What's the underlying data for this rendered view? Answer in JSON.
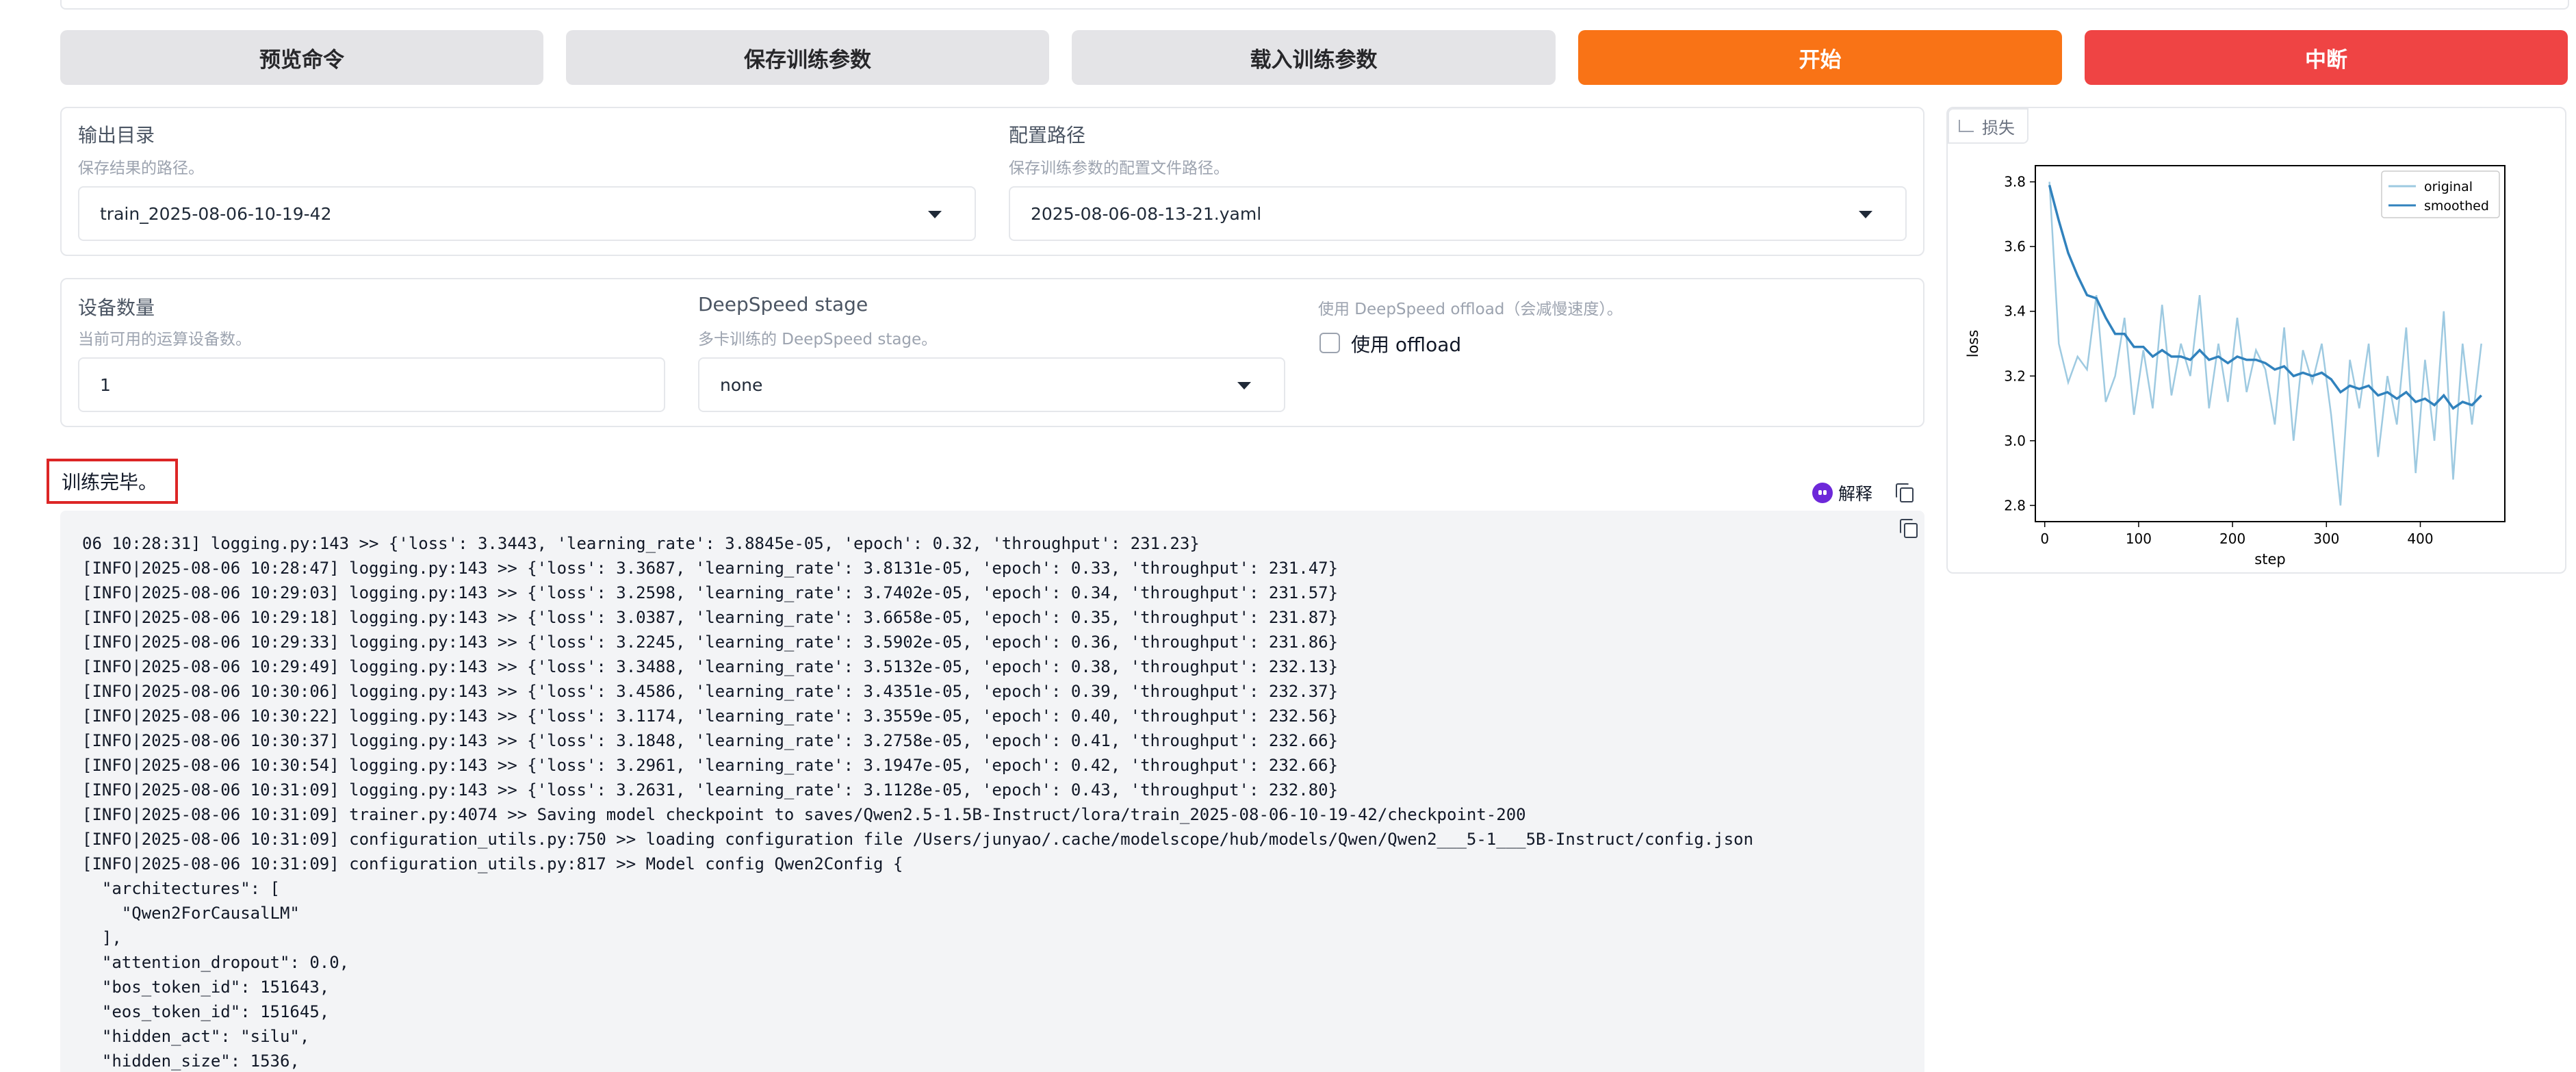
{
  "buttons": {
    "preview": "预览命令",
    "save": "保存训练参数",
    "load": "载入训练参数",
    "start": "开始",
    "abort": "中断"
  },
  "output_dir": {
    "label": "输出目录",
    "info": "保存结果的路径。",
    "value": "train_2025-08-06-10-19-42"
  },
  "config_path": {
    "label": "配置路径",
    "info": "保存训练参数的配置文件路径。",
    "value": "2025-08-06-08-13-21.yaml"
  },
  "device_count": {
    "label": "设备数量",
    "info": "当前可用的运算设备数。",
    "value": "1"
  },
  "ds_stage": {
    "label": "DeepSpeed stage",
    "info": "多卡训练的 DeepSpeed stage。",
    "value": "none"
  },
  "ds_offload": {
    "info": "使用 DeepSpeed offload（会减慢速度）。",
    "label": "使用 offload",
    "checked": false
  },
  "status_text": "训练完毕。",
  "explain_label": "解释",
  "log_lines": [
    "06 10:28:31] logging.py:143 >> {'loss': 3.3443, 'learning_rate': 3.8845e-05, 'epoch': 0.32, 'throughput': 231.23}",
    "[INFO|2025-08-06 10:28:47] logging.py:143 >> {'loss': 3.3687, 'learning_rate': 3.8131e-05, 'epoch': 0.33, 'throughput': 231.47}",
    "[INFO|2025-08-06 10:29:03] logging.py:143 >> {'loss': 3.2598, 'learning_rate': 3.7402e-05, 'epoch': 0.34, 'throughput': 231.57}",
    "[INFO|2025-08-06 10:29:18] logging.py:143 >> {'loss': 3.0387, 'learning_rate': 3.6658e-05, 'epoch': 0.35, 'throughput': 231.87}",
    "[INFO|2025-08-06 10:29:33] logging.py:143 >> {'loss': 3.2245, 'learning_rate': 3.5902e-05, 'epoch': 0.36, 'throughput': 231.86}",
    "[INFO|2025-08-06 10:29:49] logging.py:143 >> {'loss': 3.3488, 'learning_rate': 3.5132e-05, 'epoch': 0.38, 'throughput': 232.13}",
    "[INFO|2025-08-06 10:30:06] logging.py:143 >> {'loss': 3.4586, 'learning_rate': 3.4351e-05, 'epoch': 0.39, 'throughput': 232.37}",
    "[INFO|2025-08-06 10:30:22] logging.py:143 >> {'loss': 3.1174, 'learning_rate': 3.3559e-05, 'epoch': 0.40, 'throughput': 232.56}",
    "[INFO|2025-08-06 10:30:37] logging.py:143 >> {'loss': 3.1848, 'learning_rate': 3.2758e-05, 'epoch': 0.41, 'throughput': 232.66}",
    "[INFO|2025-08-06 10:30:54] logging.py:143 >> {'loss': 3.2961, 'learning_rate': 3.1947e-05, 'epoch': 0.42, 'throughput': 232.66}",
    "[INFO|2025-08-06 10:31:09] logging.py:143 >> {'loss': 3.2631, 'learning_rate': 3.1128e-05, 'epoch': 0.43, 'throughput': 232.80}",
    "[INFO|2025-08-06 10:31:09] trainer.py:4074 >> Saving model checkpoint to saves/Qwen2.5-1.5B-Instruct/lora/train_2025-08-06-10-19-42/checkpoint-200",
    "[INFO|2025-08-06 10:31:09] configuration_utils.py:750 >> loading configuration file /Users/junyao/.cache/modelscope/hub/models/Qwen/Qwen2___5-1___5B-Instruct/config.json",
    "[INFO|2025-08-06 10:31:09] configuration_utils.py:817 >> Model config Qwen2Config {",
    "  \"architectures\": [",
    "    \"Qwen2ForCausalLM\"",
    "  ],",
    "  \"attention_dropout\": 0.0,",
    "  \"bos_token_id\": 151643,",
    "  \"eos_token_id\": 151645,",
    "  \"hidden_act\": \"silu\",",
    "  \"hidden_size\": 1536,"
  ],
  "plot": {
    "tab_label": "损失",
    "colors": {
      "original": "#9ecae1",
      "smoothed": "#3182bd"
    }
  },
  "chart_data": {
    "type": "line",
    "title": "",
    "xlabel": "step",
    "ylabel": "loss",
    "xlim": [
      -10,
      490
    ],
    "ylim": [
      2.75,
      3.85
    ],
    "xticks": [
      0,
      100,
      200,
      300,
      400
    ],
    "yticks": [
      2.8,
      3.0,
      3.2,
      3.4,
      3.6,
      3.8
    ],
    "legend": "top-right",
    "series": [
      {
        "name": "original",
        "x": [
          5,
          15,
          25,
          35,
          45,
          55,
          65,
          75,
          85,
          95,
          105,
          115,
          125,
          135,
          145,
          155,
          165,
          175,
          185,
          195,
          205,
          215,
          225,
          235,
          245,
          255,
          265,
          275,
          285,
          295,
          305,
          315,
          325,
          335,
          345,
          355,
          365,
          375,
          385,
          395,
          405,
          415,
          425,
          435,
          445,
          455,
          465
        ],
        "y": [
          3.8,
          3.3,
          3.18,
          3.26,
          3.22,
          3.45,
          3.12,
          3.2,
          3.38,
          3.08,
          3.28,
          3.1,
          3.42,
          3.14,
          3.3,
          3.2,
          3.45,
          3.1,
          3.3,
          3.12,
          3.38,
          3.15,
          3.28,
          3.22,
          3.05,
          3.35,
          3.0,
          3.28,
          3.18,
          3.3,
          3.08,
          2.8,
          3.25,
          3.1,
          3.3,
          2.95,
          3.2,
          3.05,
          3.35,
          2.9,
          3.25,
          3.0,
          3.4,
          2.88,
          3.3,
          3.05,
          3.3
        ]
      },
      {
        "name": "smoothed",
        "x": [
          5,
          15,
          25,
          35,
          45,
          55,
          65,
          75,
          85,
          95,
          105,
          115,
          125,
          135,
          145,
          155,
          165,
          175,
          185,
          195,
          205,
          215,
          225,
          235,
          245,
          255,
          265,
          275,
          285,
          295,
          305,
          315,
          325,
          335,
          345,
          355,
          365,
          375,
          385,
          395,
          405,
          415,
          425,
          435,
          445,
          455,
          465
        ],
        "y": [
          3.79,
          3.68,
          3.58,
          3.51,
          3.45,
          3.44,
          3.38,
          3.33,
          3.33,
          3.29,
          3.29,
          3.26,
          3.28,
          3.26,
          3.26,
          3.25,
          3.28,
          3.25,
          3.26,
          3.24,
          3.26,
          3.25,
          3.25,
          3.24,
          3.22,
          3.23,
          3.2,
          3.21,
          3.2,
          3.21,
          3.19,
          3.15,
          3.17,
          3.16,
          3.17,
          3.14,
          3.15,
          3.13,
          3.15,
          3.12,
          3.13,
          3.11,
          3.14,
          3.1,
          3.12,
          3.11,
          3.14
        ]
      }
    ]
  }
}
